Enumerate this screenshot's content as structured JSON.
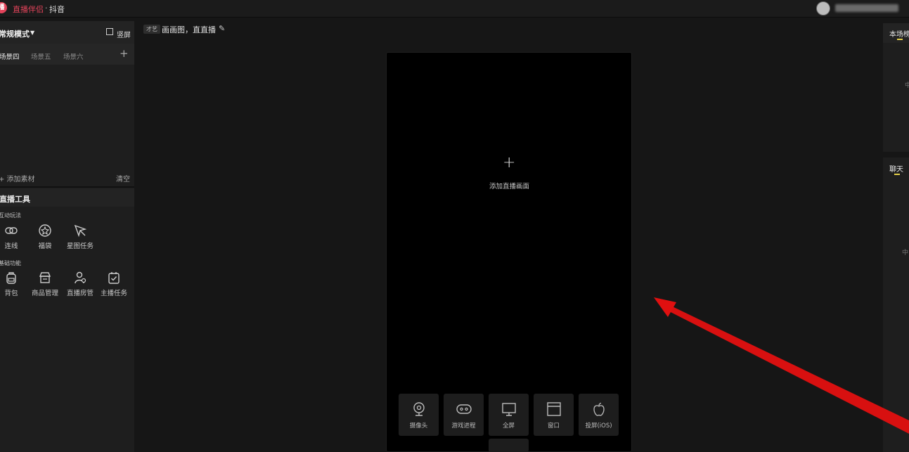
{
  "titlebar": {
    "logo": "播",
    "app_name": "直播伴侣",
    "separator": "·",
    "platform": "抖音"
  },
  "sidebar": {
    "mode": "常规模式",
    "vertical_label": "竖屏",
    "scene_tabs": [
      "场景四",
      "场景五",
      "场景六"
    ],
    "add_material": "+ 添加素材",
    "clear": "清空",
    "tools_title": "直播工具",
    "interactive_label": "互动玩法",
    "interactive_tools": [
      {
        "label": "连线",
        "icon": "link-icon"
      },
      {
        "label": "福袋",
        "icon": "blessing-bag-icon"
      },
      {
        "label": "星图任务",
        "icon": "star-task-icon"
      }
    ],
    "basic_label": "基础功能",
    "basic_tools": [
      {
        "label": "背包",
        "icon": "backpack-icon"
      },
      {
        "label": "商品管理",
        "icon": "shop-icon"
      },
      {
        "label": "直播房管",
        "icon": "room-admin-icon"
      },
      {
        "label": "主播任务",
        "icon": "task-check-icon"
      }
    ]
  },
  "center": {
    "badge": "才艺",
    "title": "画画图，直直播",
    "add_symbol": "+",
    "add_label": "添加直播画面",
    "sources": [
      {
        "label": "摄像头",
        "icon": "camera-icon"
      },
      {
        "label": "游戏进程",
        "icon": "gamepad-icon"
      },
      {
        "label": "全屏",
        "icon": "monitor-icon"
      },
      {
        "label": "窗口",
        "icon": "window-icon"
      },
      {
        "label": "投屏(iOS)",
        "icon": "apple-icon"
      }
    ]
  },
  "right": {
    "top_tab": "本场榜",
    "top_text": "中",
    "bottom_tab": "聊天",
    "bottom_text": "中"
  },
  "colors": {
    "accent": "#e2435a",
    "tab_underline": "#e6d24a",
    "arrow": "#e01010"
  }
}
